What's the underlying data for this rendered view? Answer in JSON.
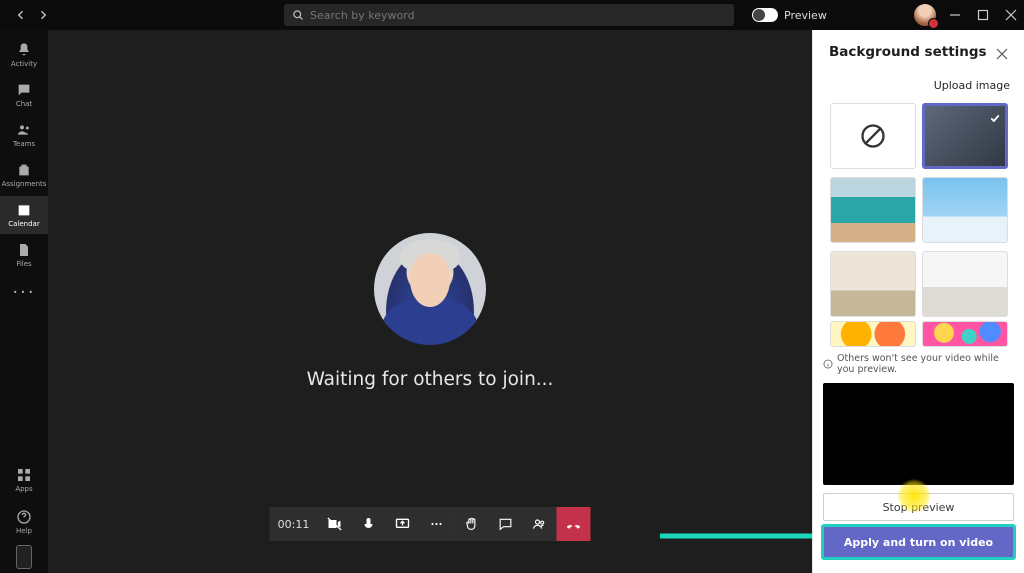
{
  "titlebar": {
    "search_placeholder": "Search by keyword",
    "preview_label": "Preview"
  },
  "rail": {
    "items": [
      {
        "id": "activity",
        "label": "Activity"
      },
      {
        "id": "chat",
        "label": "Chat"
      },
      {
        "id": "teams",
        "label": "Teams"
      },
      {
        "id": "assignments",
        "label": "Assignments"
      },
      {
        "id": "calendar",
        "label": "Calendar"
      },
      {
        "id": "files",
        "label": "Files"
      }
    ],
    "bottom": [
      {
        "id": "apps",
        "label": "Apps"
      },
      {
        "id": "help",
        "label": "Help"
      }
    ]
  },
  "stage": {
    "waiting_text": "Waiting for others to join...",
    "timer": "00:11"
  },
  "panel": {
    "title": "Background settings",
    "upload_label": "Upload image",
    "notice_text": "Others won't see your video while you preview.",
    "stop_label": "Stop preview",
    "apply_label": "Apply and turn on video",
    "tiles": [
      {
        "id": "none",
        "kind": "none",
        "selected": false
      },
      {
        "id": "blur",
        "kind": "blur",
        "selected": true
      },
      {
        "id": "office",
        "kind": "image",
        "selected": false
      },
      {
        "id": "sky",
        "kind": "image",
        "selected": false
      },
      {
        "id": "room1",
        "kind": "image",
        "selected": false
      },
      {
        "id": "room2",
        "kind": "image",
        "selected": false
      },
      {
        "id": "balloon1",
        "kind": "image",
        "selected": false
      },
      {
        "id": "balloon2",
        "kind": "image",
        "selected": false
      }
    ]
  }
}
